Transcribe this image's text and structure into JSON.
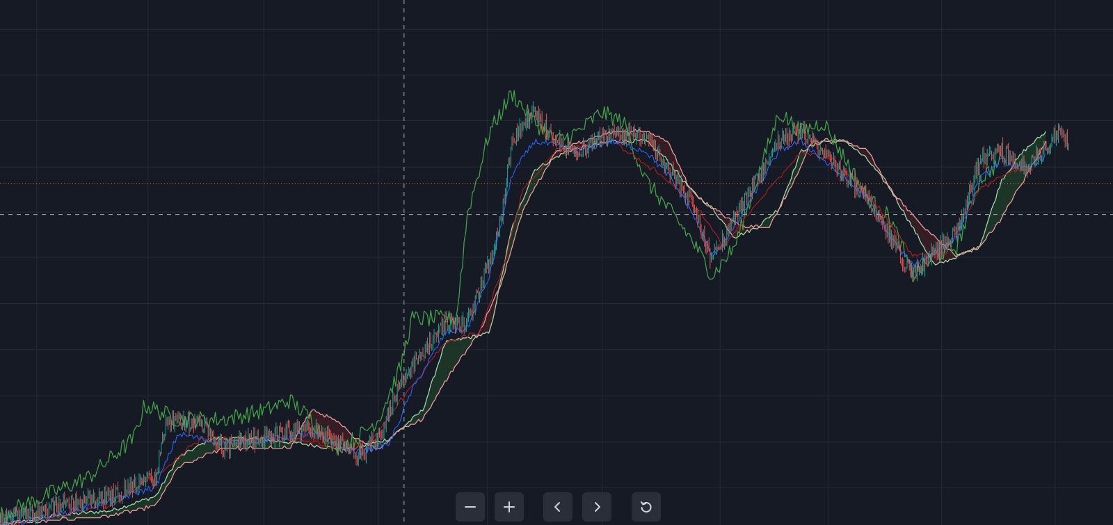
{
  "theme": {
    "background": "#161a25",
    "grid": "#262a36",
    "crosshair": "#9598a1",
    "last_price_line": "#e0703a",
    "candle_up": "#26a69a",
    "candle_down": "#ef5350",
    "tenkan_color": "#2962ff",
    "kijun_color": "#b71c1c",
    "chikou_color": "#43a047",
    "senkou_a_color": "#a5d6a7",
    "senkou_b_color": "#ef9a9a",
    "cloud_bull_fill": "#1f3a2a",
    "cloud_bear_fill": "#3a1f24"
  },
  "toolbar": {
    "zoom_out_icon": "minus-icon",
    "zoom_in_icon": "plus-icon",
    "scroll_left_icon": "chevron-left-icon",
    "scroll_right_icon": "chevron-right-icon",
    "reset_icon": "rotate-ccw-icon"
  },
  "chart_data": {
    "type": "line",
    "indicator": "ichimoku",
    "grid": true,
    "crosshair": true,
    "ylim": [
      0,
      100
    ],
    "series": [
      {
        "key": "price",
        "points": [
          [
            0,
            1
          ],
          [
            5,
            4
          ],
          [
            10,
            6
          ],
          [
            14,
            10
          ],
          [
            15,
            22
          ],
          [
            18,
            21
          ],
          [
            20,
            16
          ],
          [
            25,
            19
          ],
          [
            28,
            20
          ],
          [
            30,
            18
          ],
          [
            32,
            14
          ],
          [
            34,
            18
          ],
          [
            36,
            30
          ],
          [
            40,
            42
          ],
          [
            42,
            42
          ],
          [
            44,
            55
          ],
          [
            45,
            63
          ],
          [
            46,
            80
          ],
          [
            48,
            86
          ],
          [
            50,
            80
          ],
          [
            52,
            78
          ],
          [
            55,
            82
          ],
          [
            58,
            81
          ],
          [
            60,
            74
          ],
          [
            62,
            68
          ],
          [
            64,
            55
          ],
          [
            66,
            64
          ],
          [
            68,
            72
          ],
          [
            70,
            80
          ],
          [
            72,
            82
          ],
          [
            75,
            75
          ],
          [
            78,
            68
          ],
          [
            80,
            60
          ],
          [
            82,
            52
          ],
          [
            84,
            57
          ],
          [
            86,
            61
          ],
          [
            88,
            76
          ],
          [
            90,
            78
          ],
          [
            92,
            74
          ],
          [
            95,
            82
          ],
          [
            96,
            79
          ]
        ]
      },
      {
        "key": "tenkan",
        "points": [
          [
            0,
            0
          ],
          [
            5,
            2
          ],
          [
            10,
            5
          ],
          [
            14,
            8
          ],
          [
            16,
            19
          ],
          [
            20,
            17
          ],
          [
            25,
            18
          ],
          [
            28,
            19
          ],
          [
            30,
            17
          ],
          [
            32,
            15
          ],
          [
            35,
            17
          ],
          [
            37,
            28
          ],
          [
            40,
            40
          ],
          [
            42,
            41
          ],
          [
            44,
            52
          ],
          [
            46,
            73
          ],
          [
            48,
            80
          ],
          [
            52,
            78
          ],
          [
            55,
            80
          ],
          [
            58,
            78
          ],
          [
            60,
            73
          ],
          [
            62,
            66
          ],
          [
            64,
            56
          ],
          [
            66,
            62
          ],
          [
            68,
            70
          ],
          [
            70,
            78
          ],
          [
            72,
            80
          ],
          [
            75,
            74
          ],
          [
            78,
            68
          ],
          [
            80,
            60
          ],
          [
            82,
            54
          ],
          [
            84,
            57
          ],
          [
            86,
            60
          ],
          [
            88,
            72
          ],
          [
            90,
            76
          ],
          [
            92,
            74
          ],
          [
            94,
            77
          ]
        ]
      },
      {
        "key": "kijun",
        "points": [
          [
            0,
            0
          ],
          [
            5,
            2
          ],
          [
            10,
            4
          ],
          [
            15,
            12
          ],
          [
            18,
            18
          ],
          [
            22,
            18
          ],
          [
            27,
            18
          ],
          [
            30,
            16
          ],
          [
            33,
            16
          ],
          [
            36,
            26
          ],
          [
            40,
            38
          ],
          [
            43,
            40
          ],
          [
            45,
            52
          ],
          [
            47,
            70
          ],
          [
            50,
            78
          ],
          [
            55,
            80
          ],
          [
            60,
            72
          ],
          [
            63,
            65
          ],
          [
            65,
            58
          ],
          [
            68,
            67
          ],
          [
            72,
            78
          ],
          [
            75,
            76
          ],
          [
            79,
            66
          ],
          [
            82,
            56
          ],
          [
            85,
            57
          ],
          [
            88,
            70
          ],
          [
            91,
            74
          ],
          [
            93,
            74
          ]
        ]
      },
      {
        "key": "chikou",
        "points": [
          [
            0,
            2
          ],
          [
            4,
            6
          ],
          [
            8,
            10
          ],
          [
            12,
            18
          ],
          [
            13,
            25
          ],
          [
            16,
            22
          ],
          [
            20,
            22
          ],
          [
            24,
            24
          ],
          [
            26,
            26
          ],
          [
            28,
            22
          ],
          [
            30,
            16
          ],
          [
            32,
            18
          ],
          [
            34,
            22
          ],
          [
            36,
            33
          ],
          [
            37,
            43
          ],
          [
            39,
            43
          ],
          [
            41,
            43
          ],
          [
            42,
            65
          ],
          [
            44,
            82
          ],
          [
            46,
            90
          ],
          [
            48,
            84
          ],
          [
            50,
            80
          ],
          [
            52,
            82
          ],
          [
            54,
            86
          ],
          [
            56,
            84
          ],
          [
            58,
            72
          ],
          [
            60,
            66
          ],
          [
            62,
            60
          ],
          [
            64,
            52
          ],
          [
            66,
            58
          ],
          [
            68,
            72
          ],
          [
            70,
            86
          ],
          [
            72,
            82
          ],
          [
            74,
            84
          ],
          [
            76,
            76
          ],
          [
            78,
            68
          ],
          [
            80,
            64
          ],
          [
            82,
            52
          ],
          [
            84,
            56
          ],
          [
            86,
            58
          ],
          [
            88,
            72
          ],
          [
            90,
            76
          ]
        ]
      },
      {
        "key": "senkou_a",
        "points": [
          [
            0,
            0
          ],
          [
            5,
            2
          ],
          [
            10,
            3
          ],
          [
            14,
            6
          ],
          [
            16,
            14
          ],
          [
            19,
            18
          ],
          [
            23,
            18
          ],
          [
            27,
            17
          ],
          [
            30,
            16
          ],
          [
            32,
            16
          ],
          [
            35,
            18
          ],
          [
            38,
            24
          ],
          [
            40,
            38
          ],
          [
            44,
            40
          ],
          [
            46,
            62
          ],
          [
            48,
            74
          ],
          [
            51,
            78
          ],
          [
            55,
            80
          ],
          [
            58,
            80
          ],
          [
            60,
            76
          ],
          [
            62,
            70
          ],
          [
            64,
            66
          ],
          [
            66,
            60
          ],
          [
            68,
            62
          ],
          [
            70,
            66
          ],
          [
            72,
            78
          ],
          [
            74,
            80
          ],
          [
            76,
            80
          ],
          [
            78,
            76
          ],
          [
            80,
            70
          ],
          [
            82,
            62
          ],
          [
            84,
            54
          ],
          [
            86,
            56
          ],
          [
            88,
            58
          ],
          [
            90,
            72
          ],
          [
            92,
            78
          ],
          [
            94,
            82
          ]
        ]
      },
      {
        "key": "senkou_b",
        "points": [
          [
            0,
            0
          ],
          [
            5,
            1
          ],
          [
            10,
            2
          ],
          [
            14,
            4
          ],
          [
            16,
            12
          ],
          [
            20,
            16
          ],
          [
            26,
            16
          ],
          [
            28,
            24
          ],
          [
            30,
            22
          ],
          [
            32,
            18
          ],
          [
            34,
            16
          ],
          [
            36,
            20
          ],
          [
            38,
            22
          ],
          [
            40,
            30
          ],
          [
            43,
            40
          ],
          [
            45,
            50
          ],
          [
            47,
            66
          ],
          [
            50,
            78
          ],
          [
            55,
            82
          ],
          [
            58,
            82
          ],
          [
            60,
            80
          ],
          [
            62,
            70
          ],
          [
            64,
            66
          ],
          [
            67,
            62
          ],
          [
            69,
            62
          ],
          [
            71,
            70
          ],
          [
            73,
            80
          ],
          [
            76,
            80
          ],
          [
            78,
            78
          ],
          [
            80,
            70
          ],
          [
            83,
            62
          ],
          [
            86,
            56
          ],
          [
            88,
            58
          ],
          [
            90,
            64
          ],
          [
            92,
            72
          ],
          [
            94,
            80
          ]
        ]
      }
    ],
    "crosshair_x": 36.3,
    "crosshair_y": 64.7,
    "last_price": 71.2,
    "grid_x": [
      3.3,
      13.3,
      23.7,
      34,
      43.8,
      54.1,
      64.7,
      74.4,
      84.6,
      94.8
    ],
    "grid_y": [
      5.6,
      14.3,
      23,
      31.8,
      40.4,
      49,
      57.8,
      66.6,
      75.4,
      84.2,
      92.8,
      101.5
    ]
  }
}
